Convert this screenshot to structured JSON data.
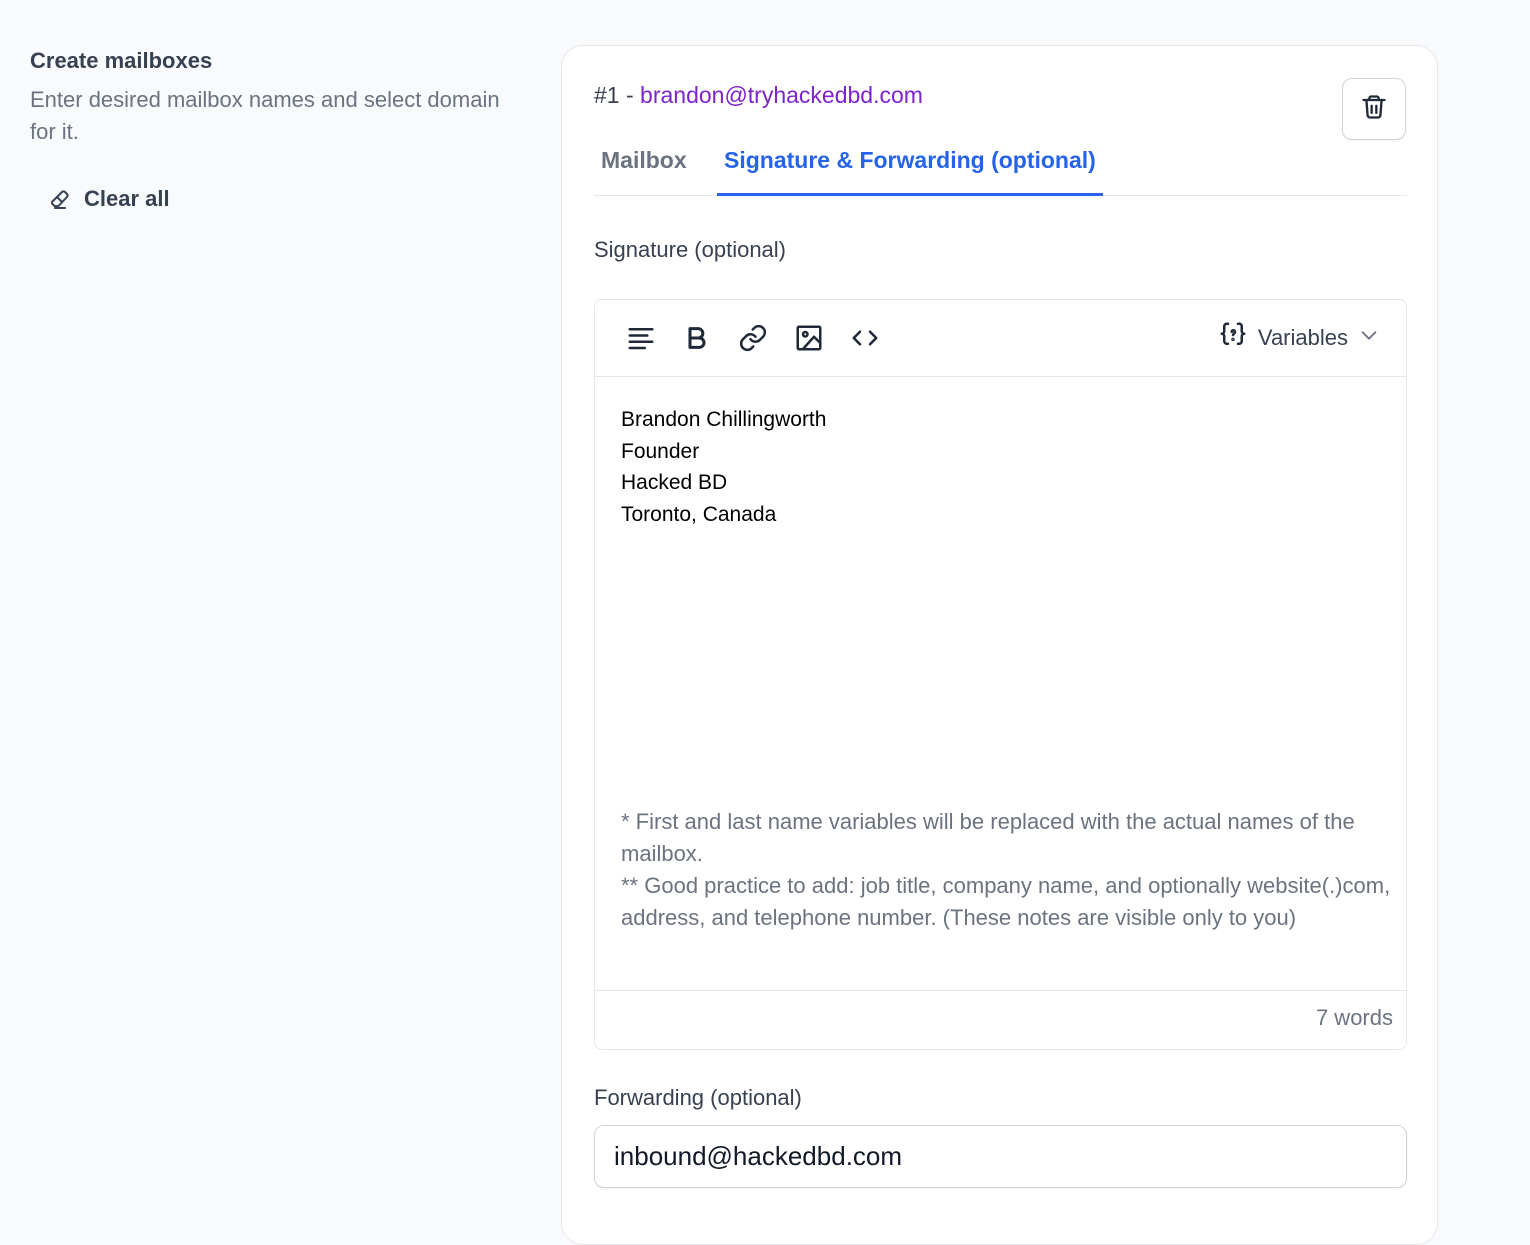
{
  "section": {
    "title": "Create mailboxes",
    "description": "Enter desired mailbox names and select domain for it.",
    "clear_all_label": "Clear all"
  },
  "mailbox": {
    "index_label": "#1 - ",
    "email": "brandon@tryhackedbd.com"
  },
  "tabs": [
    {
      "label": "Mailbox",
      "active": false
    },
    {
      "label": "Signature & Forwarding (optional)",
      "active": true
    }
  ],
  "signature": {
    "label": "Signature (optional)",
    "toolbar": {
      "icons": [
        "align-left-icon",
        "bold-icon",
        "link-icon",
        "image-icon",
        "code-icon"
      ],
      "variables_label": "Variables"
    },
    "content_lines": [
      "Brandon Chillingworth",
      "Founder",
      "Hacked BD",
      "Toronto, Canada"
    ],
    "notes": [
      "* First and last name variables will be replaced with the actual names of the mailbox.",
      "** Good practice to add: job title, company name, and optionally website(.)com, address, and telephone number. (These notes are visible only to you)"
    ],
    "word_count": "7 words"
  },
  "forwarding": {
    "label": "Forwarding (optional)",
    "value": "inbound@hackedbd.com"
  },
  "colors": {
    "accent_blue": "#2563eb",
    "email_purple": "#7e22ce",
    "page_bg": "#f9fafb"
  }
}
